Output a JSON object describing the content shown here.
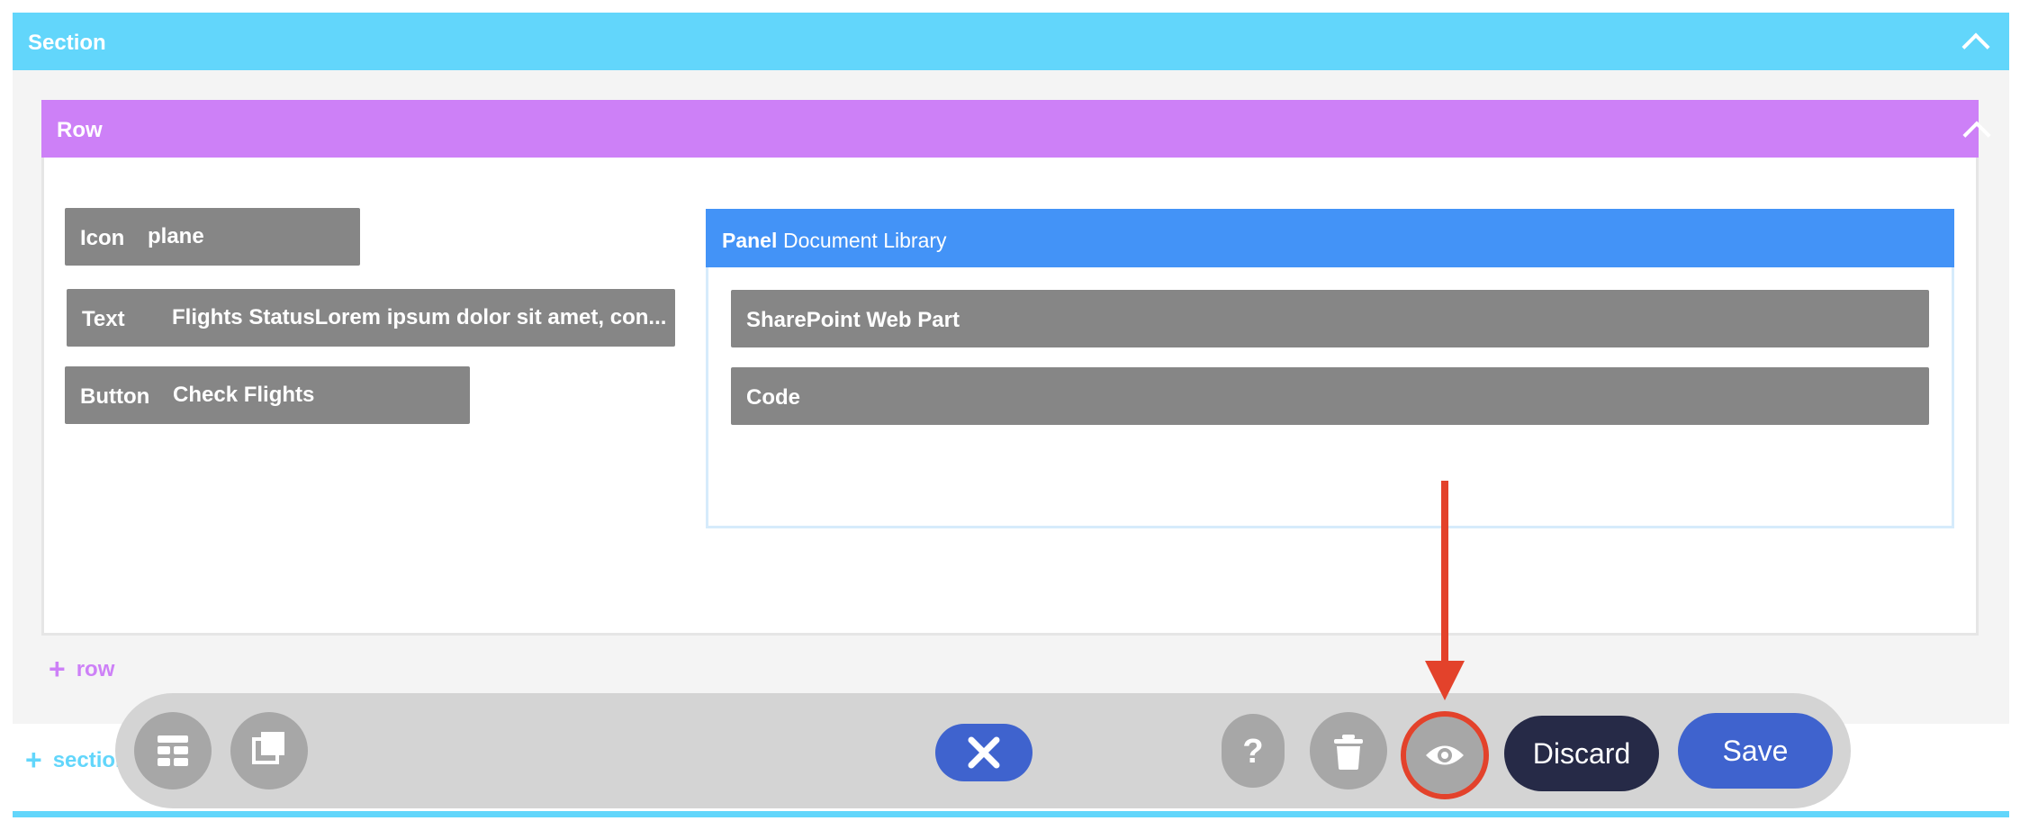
{
  "section": {
    "title": "Section",
    "add_label": "section"
  },
  "row": {
    "title": "Row",
    "add_label": "row"
  },
  "components": [
    {
      "kind": "Icon",
      "value": "plane"
    },
    {
      "kind": "Text",
      "value": "Flights StatusLorem ipsum dolor sit amet, con..."
    },
    {
      "kind": "Button",
      "value": "Check Flights"
    }
  ],
  "panel": {
    "kind": "Panel",
    "title": "Document Library",
    "items": [
      "SharePoint Web Part",
      "Code"
    ]
  },
  "toolbar": {
    "discard_label": "Discard",
    "save_label": "Save",
    "icons": [
      "layout-icon",
      "copy-icon",
      "close-icon",
      "help-icon",
      "trash-icon",
      "eye-icon"
    ]
  },
  "colors": {
    "section": "#62d6fb",
    "row": "#cd80f7",
    "panel": "#4393f7",
    "component": "#868686",
    "primary": "#3f63ce",
    "dark": "#262a47",
    "annotation": "#e3422b"
  }
}
